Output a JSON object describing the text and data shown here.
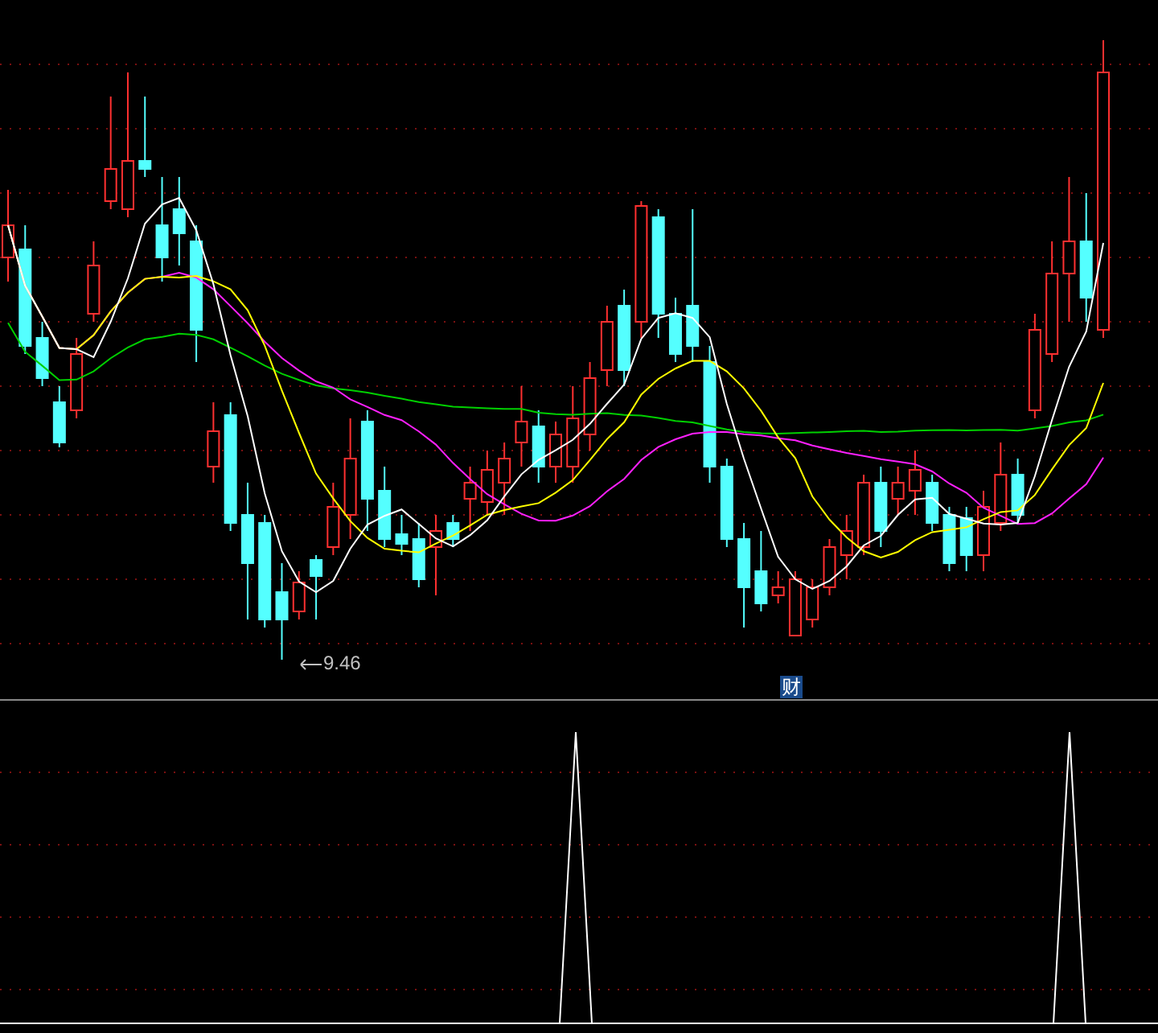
{
  "price_panel": {
    "low_label": "9.46",
    "event_badge": "财"
  }
}
